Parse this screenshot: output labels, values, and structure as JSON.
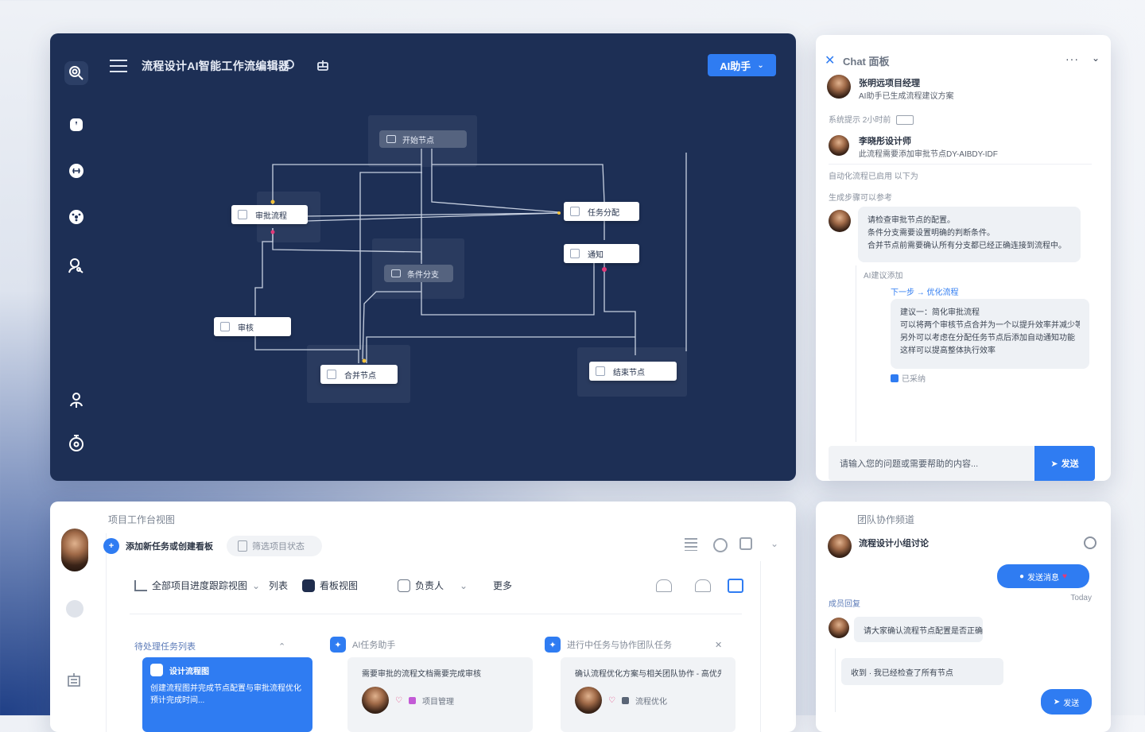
{
  "canvas": {
    "title": "流程设计AI智能工作流编辑器",
    "ai_button": "AI助手",
    "nodes": {
      "start": "开始节点",
      "left": "审批流程",
      "middle": "条件分支",
      "right_top": "任务分配",
      "right_mid": "通知",
      "lower_left": "审核",
      "bottom_center": "合并节点",
      "bottom_right": "结束节点"
    }
  },
  "chat_top": {
    "title": "Chat 面板",
    "more": "···",
    "messages": [
      {
        "name": "张明远项目经理",
        "text": "AI助手已生成流程建议方案"
      },
      {
        "name": "李晓彤设计师",
        "text": "此流程需要添加审批节点DY-AIBDY-IDF"
      }
    ],
    "meta_1": "系统提示 2小时前",
    "meta_2": "自动化流程已启用 以下为",
    "meta_3": "生成步骤可以参考",
    "bubble_1": [
      "请检查审批节点的配置。",
      "条件分支需要设置明确的判断条件。",
      "合并节点前需要确认所有分支都已经正确连接到流程中。"
    ],
    "meta_4": "AI建议添加",
    "link": "下一步 → 优化流程",
    "bubble_2": [
      "建议一：简化审批流程",
      "可以将两个审核节点合并为一个以提升效率并减少等待时间",
      "另外可以考虑在分配任务节点后添加自动通知功能",
      "这样可以提高整体执行效率"
    ],
    "tag": "已采纳",
    "input_placeholder": "请输入您的问题或需要帮助的内容...",
    "send": "发送"
  },
  "workspace": {
    "title": "项目工作台视图",
    "add_chip": "添加新任务或创建看板",
    "filter_chip": "筛选项目状态",
    "toolbar": [
      "全部项目进度跟踪视图",
      "列表",
      "看板视图",
      "负责人",
      "更多"
    ],
    "col_1": "待处理任务列表",
    "col_2": "AI任务助手",
    "col_3": "进行中任务与协作团队任务",
    "card_1": {
      "title": "设计流程图",
      "line1": "创建流程图并完成节点配置与审批流程优化",
      "line2": "预计完成时间..."
    },
    "card_2": {
      "title": "需要审批的流程文档需要完成审核",
      "tag": "项目管理"
    },
    "card_3": {
      "title": "确认流程优化方案与相关团队协作 - 高优先",
      "tag": "流程优化"
    }
  },
  "chat_bottom": {
    "title": "团队协作频道",
    "sender": "流程设计小组讨论",
    "out_1": "发送消息",
    "time": "Today",
    "meta": "成员回复",
    "in_1": "请大家确认流程节点配置是否正确",
    "in_2": "收到 · 我已经检查了所有节点",
    "out_2": "发送"
  }
}
